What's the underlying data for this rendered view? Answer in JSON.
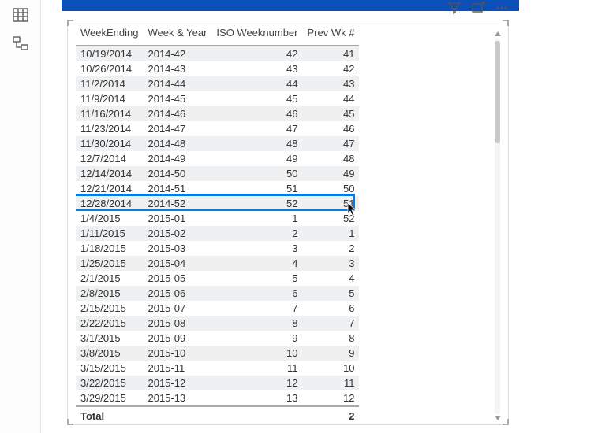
{
  "nav": {
    "icon_table": "table-view-icon",
    "icon_model": "model-view-icon"
  },
  "header_icons": {
    "filter": "filter-icon",
    "focus": "focus-mode-icon",
    "more": "more-options-icon"
  },
  "table": {
    "columns": [
      "WeekEnding",
      "Week & Year",
      "ISO Weeknumber",
      "Prev Wk #"
    ],
    "rows": [
      {
        "week_ending": "10/19/2014",
        "wy": "2014-42",
        "iso": 42,
        "prev": 41
      },
      {
        "week_ending": "10/26/2014",
        "wy": "2014-43",
        "iso": 43,
        "prev": 42
      },
      {
        "week_ending": "11/2/2014",
        "wy": "2014-44",
        "iso": 44,
        "prev": 43
      },
      {
        "week_ending": "11/9/2014",
        "wy": "2014-45",
        "iso": 45,
        "prev": 44
      },
      {
        "week_ending": "11/16/2014",
        "wy": "2014-46",
        "iso": 46,
        "prev": 45
      },
      {
        "week_ending": "11/23/2014",
        "wy": "2014-47",
        "iso": 47,
        "prev": 46
      },
      {
        "week_ending": "11/30/2014",
        "wy": "2014-48",
        "iso": 48,
        "prev": 47
      },
      {
        "week_ending": "12/7/2014",
        "wy": "2014-49",
        "iso": 49,
        "prev": 48
      },
      {
        "week_ending": "12/14/2014",
        "wy": "2014-50",
        "iso": 50,
        "prev": 49
      },
      {
        "week_ending": "12/21/2014",
        "wy": "2014-51",
        "iso": 51,
        "prev": 50
      },
      {
        "week_ending": "12/28/2014",
        "wy": "2014-52",
        "iso": 52,
        "prev": 51,
        "highlight": true
      },
      {
        "week_ending": "1/4/2015",
        "wy": "2015-01",
        "iso": 1,
        "prev": 52
      },
      {
        "week_ending": "1/11/2015",
        "wy": "2015-02",
        "iso": 2,
        "prev": 1
      },
      {
        "week_ending": "1/18/2015",
        "wy": "2015-03",
        "iso": 3,
        "prev": 2
      },
      {
        "week_ending": "1/25/2015",
        "wy": "2015-04",
        "iso": 4,
        "prev": 3
      },
      {
        "week_ending": "2/1/2015",
        "wy": "2015-05",
        "iso": 5,
        "prev": 4
      },
      {
        "week_ending": "2/8/2015",
        "wy": "2015-06",
        "iso": 6,
        "prev": 5
      },
      {
        "week_ending": "2/15/2015",
        "wy": "2015-07",
        "iso": 7,
        "prev": 6
      },
      {
        "week_ending": "2/22/2015",
        "wy": "2015-08",
        "iso": 8,
        "prev": 7
      },
      {
        "week_ending": "3/1/2015",
        "wy": "2015-09",
        "iso": 9,
        "prev": 8
      },
      {
        "week_ending": "3/8/2015",
        "wy": "2015-10",
        "iso": 10,
        "prev": 9
      },
      {
        "week_ending": "3/15/2015",
        "wy": "2015-11",
        "iso": 11,
        "prev": 10
      },
      {
        "week_ending": "3/22/2015",
        "wy": "2015-12",
        "iso": 12,
        "prev": 11
      },
      {
        "week_ending": "3/29/2015",
        "wy": "2015-13",
        "iso": 13,
        "prev": 12
      }
    ],
    "footer": {
      "label": "Total",
      "value": 2
    }
  }
}
